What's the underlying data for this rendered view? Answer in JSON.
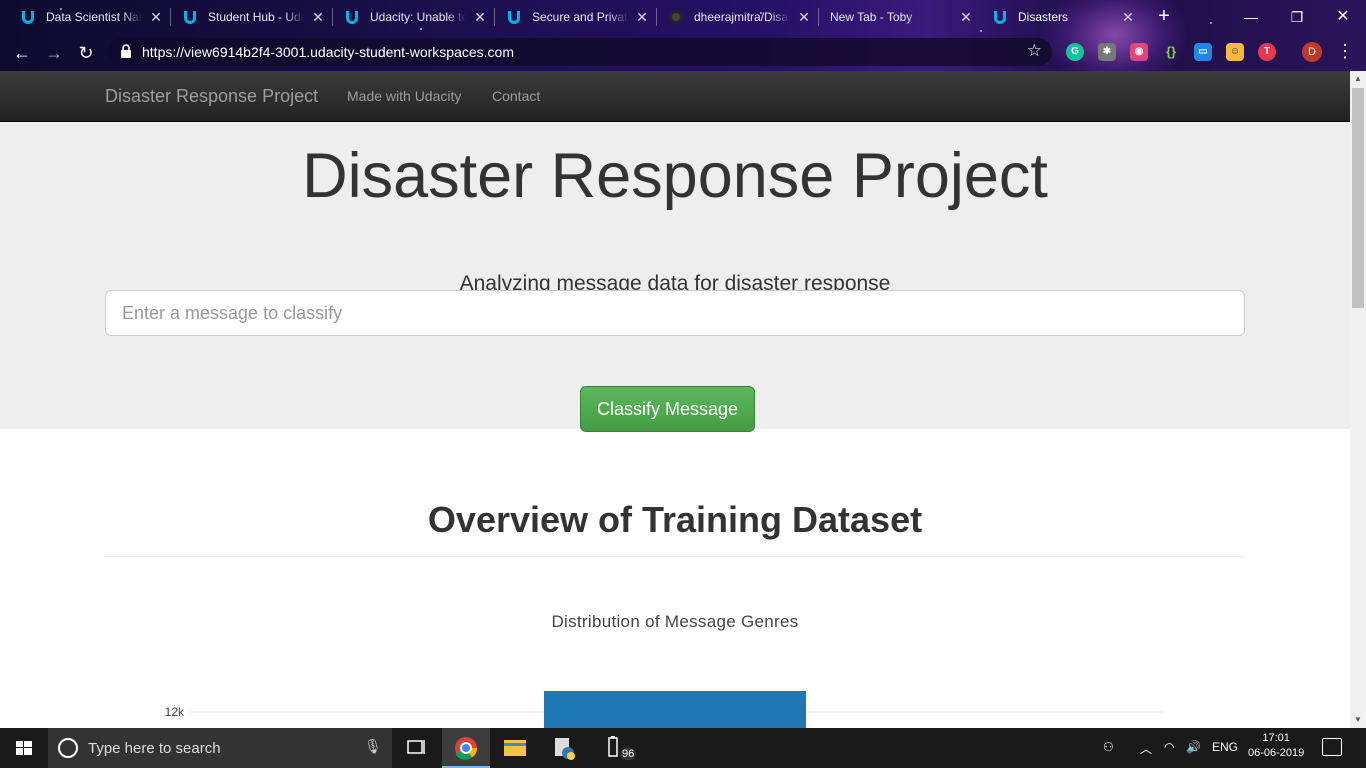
{
  "browser": {
    "tabs": [
      {
        "title": "Data Scientist Nanodegree",
        "icon": "udacity-icon"
      },
      {
        "title": "Student Hub - Udacity",
        "icon": "udacity-icon"
      },
      {
        "title": "Udacity: Unable to load",
        "icon": "udacity-icon"
      },
      {
        "title": "Secure and Private",
        "icon": "udacity-icon"
      },
      {
        "title": "dheerajmitra/Disaster",
        "icon": "github-icon"
      },
      {
        "title": "New Tab - Toby",
        "icon": "toby-icon"
      },
      {
        "title": "Disasters",
        "icon": "udacity-icon",
        "active": true
      }
    ],
    "url": "https://view6914b2f4-3001.udacity-student-workspaces.com",
    "profile_initial": "D"
  },
  "navbar": {
    "brand": "Disaster Response Project",
    "links": [
      "Made with Udacity",
      "Contact"
    ]
  },
  "jumbotron": {
    "title": "Disaster Response Project",
    "lead": "Analyzing message data for disaster response",
    "input_placeholder": "Enter a message to classify",
    "button_label": "Classify Message"
  },
  "overview": {
    "heading": "Overview of Training Dataset"
  },
  "chart_data": {
    "type": "bar",
    "title": "Distribution of Message Genres",
    "visible_ticks": [
      "12k"
    ],
    "bar_color": "#1f77b4",
    "note": "Chart is cut off at viewport bottom; only the top of one bar and the 12k tick are visible"
  },
  "taskbar": {
    "search_placeholder": "Type here to search",
    "battery": "96",
    "language": "ENG",
    "time": "17:01",
    "date": "06-06-2019"
  }
}
